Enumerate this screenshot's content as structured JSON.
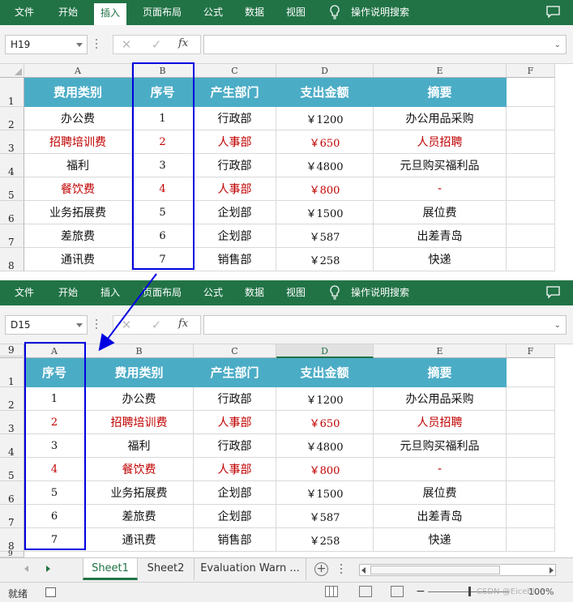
{
  "ribbon_tabs": [
    "文件",
    "开始",
    "插入",
    "页面布局",
    "公式",
    "数据",
    "视图"
  ],
  "ribbon_active_top": "插入",
  "ribbon_search": "操作说明搜索",
  "panel1": {
    "namebox": "H19",
    "columns": [
      "A",
      "B",
      "C",
      "D",
      "E",
      "F"
    ],
    "rows": [
      "1",
      "2",
      "3",
      "4",
      "5",
      "6",
      "7",
      "8"
    ],
    "table": [
      [
        "费用类别",
        "序号",
        "产生部门",
        "支出金额",
        "摘要"
      ],
      [
        "办公费",
        "1",
        "行政部",
        "￥1200",
        "办公用品采购"
      ],
      [
        "招聘培训费",
        "2",
        "人事部",
        "￥650",
        "人员招聘"
      ],
      [
        "福利",
        "3",
        "行政部",
        "￥4800",
        "元旦购买福利品"
      ],
      [
        "餐饮费",
        "4",
        "人事部",
        "￥800",
        "-"
      ],
      [
        "业务拓展费",
        "5",
        "企划部",
        "￥1500",
        "展位费"
      ],
      [
        "差旅费",
        "6",
        "企划部",
        "￥587",
        "出差青岛"
      ],
      [
        "通讯费",
        "7",
        "销售部",
        "￥258",
        "快递"
      ]
    ]
  },
  "panel2": {
    "namebox": "D15",
    "columns": [
      "A",
      "B",
      "C",
      "D",
      "E",
      "F"
    ],
    "rows": [
      "1",
      "2",
      "3",
      "4",
      "5",
      "6",
      "7",
      "8",
      "9"
    ],
    "table": [
      [
        "序号",
        "费用类别",
        "产生部门",
        "支出金额",
        "摘要"
      ],
      [
        "1",
        "办公费",
        "行政部",
        "￥1200",
        "办公用品采购"
      ],
      [
        "2",
        "招聘培训费",
        "人事部",
        "￥650",
        "人员招聘"
      ],
      [
        "3",
        "福利",
        "行政部",
        "￥4800",
        "元旦购买福利品"
      ],
      [
        "4",
        "餐饮费",
        "人事部",
        "￥800",
        "-"
      ],
      [
        "5",
        "业务拓展费",
        "企划部",
        "￥1500",
        "展位费"
      ],
      [
        "6",
        "差旅费",
        "企划部",
        "￥587",
        "出差青岛"
      ],
      [
        "7",
        "通讯费",
        "销售部",
        "￥258",
        "快递"
      ]
    ],
    "sheets": [
      "Sheet1",
      "Sheet2",
      "Evaluation Warn ..."
    ],
    "active_sheet": "Sheet1",
    "status": "就绪",
    "zoom": "100%",
    "watermark": "CSDN @Eiceblue"
  },
  "red_rows": [
    2,
    4
  ],
  "colors": {
    "ribbon": "#217346",
    "header_fill": "#4bacc6",
    "red_text": "#c00000",
    "highlight_box": "#0000e0"
  },
  "icons": [
    "lightbulb-icon",
    "comment-icon",
    "cancel-icon",
    "enter-icon",
    "function-icon"
  ]
}
